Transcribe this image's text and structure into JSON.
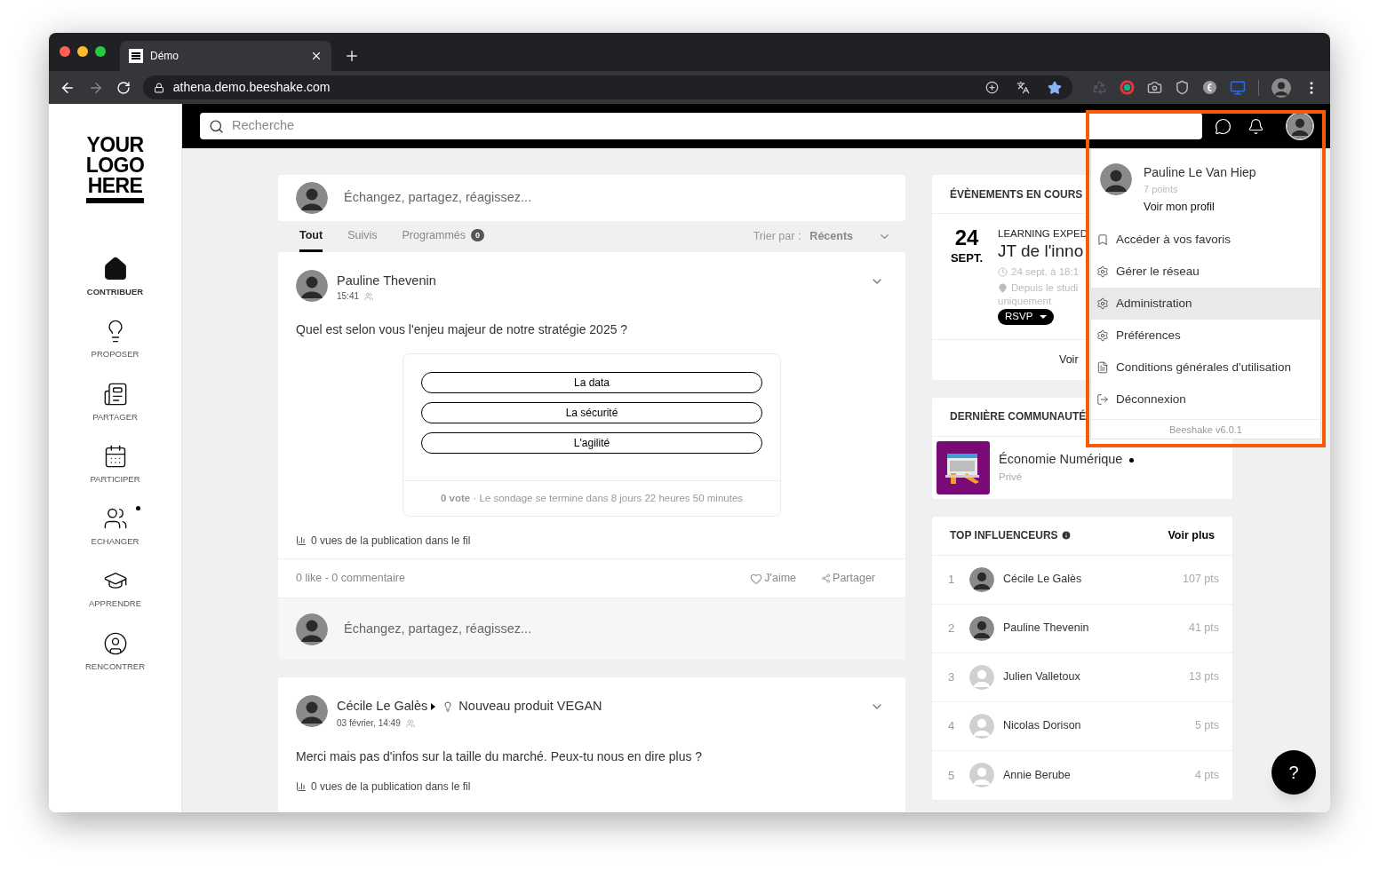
{
  "browser": {
    "tab_title": "Démo",
    "url": "athena.demo.beeshake.com",
    "bookmarked": true
  },
  "sidebar": {
    "logo": [
      "YOUR",
      "LOGO",
      "HERE"
    ],
    "items": [
      {
        "label": "CONTRIBUER",
        "selected": true,
        "unread": false
      },
      {
        "label": "PROPOSER",
        "selected": false,
        "unread": false
      },
      {
        "label": "PARTAGER",
        "selected": false,
        "unread": false
      },
      {
        "label": "PARTICIPER",
        "selected": false,
        "unread": false
      },
      {
        "label": "ECHANGER",
        "selected": false,
        "unread": true
      },
      {
        "label": "APPRENDRE",
        "selected": false,
        "unread": false
      },
      {
        "label": "RENCONTRER",
        "selected": false,
        "unread": false
      }
    ]
  },
  "header": {
    "search_placeholder": "Recherche"
  },
  "composer": {
    "placeholder": "Échangez, partagez, réagissez..."
  },
  "feed_tabs": [
    {
      "label": "Tout",
      "selected": true
    },
    {
      "label": "Suivis",
      "selected": false
    },
    {
      "label": "Programmés",
      "selected": false,
      "count": "0"
    }
  ],
  "sort": {
    "label": "Trier par :",
    "value": "Récents"
  },
  "posts": [
    {
      "author": "Pauline Thevenin",
      "time": "15:41",
      "text": "Quel est selon vous l'enjeu majeur de notre stratégie 2025 ?",
      "options": [
        {
          "label": "La data"
        },
        {
          "label": "La sécurité"
        },
        {
          "label": "L'agilité"
        }
      ],
      "poll_footer": "**0 vote** · Le sondage se termine dans 8 jours 22 heures 50 minutes",
      "views": "0 vues de la publication dans le fil",
      "stats": "0 like - 0 commentaire",
      "like": "J'aime",
      "share": "Partager",
      "comment_placeholder": "Échangez, partagez, réagissez..."
    },
    {
      "author": "Cécile Le Galès",
      "topic": "Nouveau produit VEGAN",
      "time": "03 février, 14:49",
      "text": "Merci mais pas d'infos sur la taille du marché. Peux-tu nous en dire plus ?",
      "views": "0 vues de la publication dans le fil"
    }
  ],
  "events": {
    "title": "ÉVÈNEMENTS EN COURS",
    "items": [
      {
        "day": "24",
        "month": "SEPT.",
        "category": "LEARNING EXPED",
        "title": "JT de l'inno",
        "time": "24 sept. à 18:1",
        "place": "Depuis le studi",
        "place_more": "uniquement",
        "rsvp": "RSVP"
      }
    ],
    "more": "Voir"
  },
  "community": {
    "title": "DERNIÈRE COMMUNAUTÉ",
    "name": "Économie Numérique",
    "unread": true,
    "privacy": "Privé"
  },
  "influencers": {
    "title": "TOP INFLUENCEURS",
    "more": "Voir plus",
    "rows": [
      {
        "rank": "1",
        "name": "Cécile Le Galès",
        "points": "107 pts"
      },
      {
        "rank": "2",
        "name": "Pauline Thevenin",
        "points": "41 pts"
      },
      {
        "rank": "3",
        "name": "Julien Valletoux",
        "points": "13 pts",
        "kind": "default"
      },
      {
        "rank": "4",
        "name": "Nicolas Dorison",
        "points": "5 pts",
        "kind": "default"
      },
      {
        "rank": "5",
        "name": "Annie Berube",
        "points": "4 pts",
        "kind": "default"
      }
    ]
  },
  "user_menu": {
    "name": "Pauline Le Van Hiep",
    "points": "7 points",
    "profile_link": "Voir mon profil",
    "items": [
      {
        "label": "Accéder à vos favoris",
        "highlighted": false
      },
      {
        "label": "Gérer le réseau",
        "highlighted": false
      },
      {
        "label": "Administration",
        "highlighted": true
      },
      {
        "label": "Préférences",
        "highlighted": false
      },
      {
        "label": "Conditions générales d'utilisation",
        "highlighted": false
      },
      {
        "label": "Déconnexion",
        "highlighted": false
      }
    ],
    "version": "Beeshake v6.0.1"
  },
  "help": "?"
}
